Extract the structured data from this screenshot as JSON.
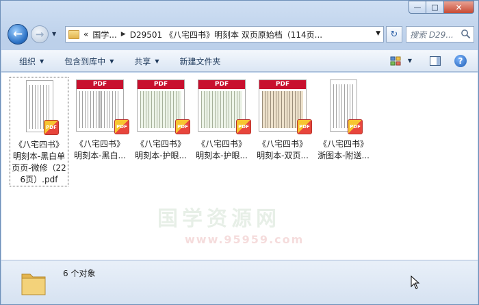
{
  "window": {
    "minimize_label": "—",
    "maximize_label": "□",
    "close_label": "✕"
  },
  "nav": {
    "back_glyph": "←",
    "forward_glyph": "→",
    "refresh_glyph": "↻"
  },
  "address": {
    "prefix": "«",
    "parts": [
      "国学...",
      "D29501 《八宅四书》明刻本 双页原始档（114页..."
    ]
  },
  "search": {
    "placeholder": "搜索 D29..."
  },
  "toolbar": {
    "organize": "组织",
    "include_in_library": "包含到库中",
    "share": "共享",
    "new_folder": "新建文件夹",
    "help": "?"
  },
  "files": [
    {
      "line1": "《八宅四书》",
      "line2": "明刻本-黑白单页页-微修（226页）.pdf",
      "style": "plain",
      "pdfhead": "",
      "selected": true
    },
    {
      "line1": "《八宅四书》",
      "line2": "明刻本-黑白...",
      "style": "split",
      "pdfhead": "PDF",
      "selected": false
    },
    {
      "line1": "《八宅四书》",
      "line2": "明刻本-护眼...",
      "style": "green",
      "pdfhead": "PDF",
      "selected": false
    },
    {
      "line1": "《八宅四书》",
      "line2": "明刻本-护眼...",
      "style": "green-split",
      "pdfhead": "PDF",
      "selected": false
    },
    {
      "line1": "《八宅四书》",
      "line2": "明刻本-双页...",
      "style": "old",
      "pdfhead": "PDF",
      "selected": false
    },
    {
      "line1": "《八宅四书》",
      "line2": "浙图本-附送...",
      "style": "plain",
      "pdfhead": "",
      "selected": false
    }
  ],
  "badge_text": "PDF",
  "watermark": {
    "line1": "国学资源网",
    "line2": "www.95959.com"
  },
  "status": {
    "count_text": "6 个对象"
  }
}
